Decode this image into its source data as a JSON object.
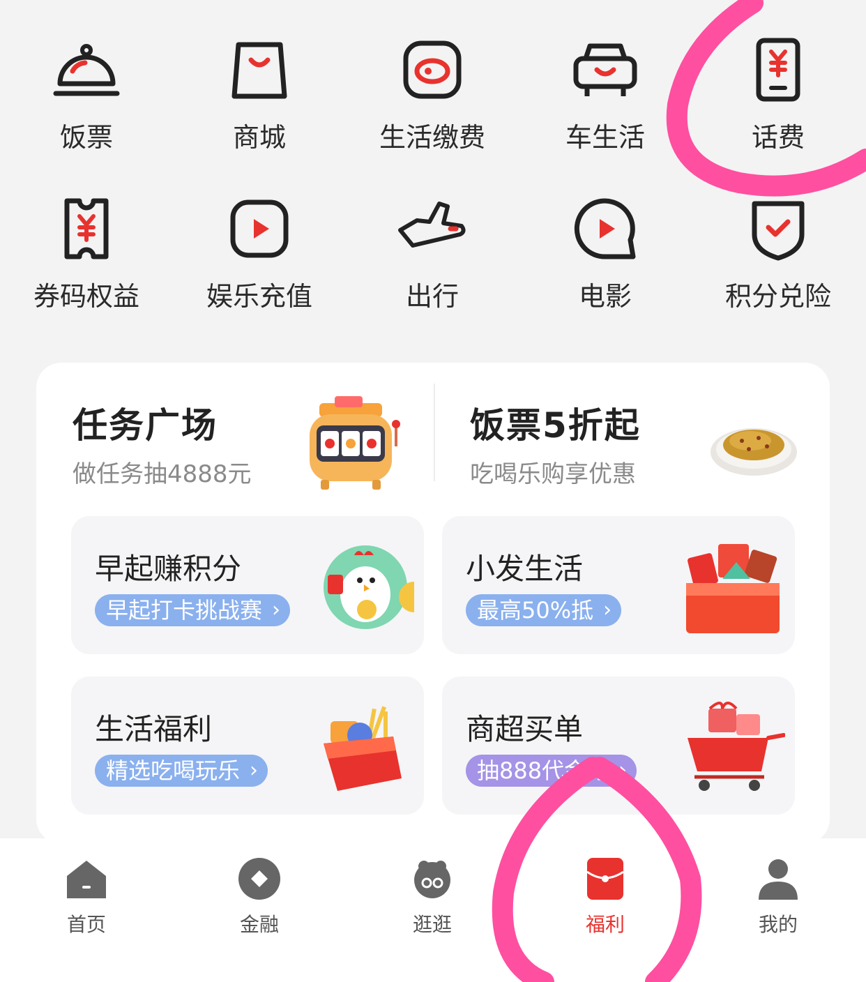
{
  "grid": {
    "row1": [
      {
        "label": "饭票",
        "icon": "cloche-icon"
      },
      {
        "label": "商城",
        "icon": "shopping-bag-icon"
      },
      {
        "label": "生活缴费",
        "icon": "bill-pay-icon"
      },
      {
        "label": "车生活",
        "icon": "car-icon"
      },
      {
        "label": "话费",
        "icon": "phone-bill-icon"
      }
    ],
    "row2": [
      {
        "label": "券码权益",
        "icon": "coupon-icon"
      },
      {
        "label": "娱乐充值",
        "icon": "play-icon"
      },
      {
        "label": "出行",
        "icon": "plane-icon"
      },
      {
        "label": "电影",
        "icon": "movie-icon"
      },
      {
        "label": "积分兑险",
        "icon": "shield-check-icon"
      }
    ]
  },
  "promos": [
    {
      "title": "任务广场",
      "subtitle": "做任务抽4888元"
    },
    {
      "title": "饭票5折起",
      "subtitle": "吃喝乐购享优惠"
    }
  ],
  "tiles": [
    {
      "title": "早起赚积分",
      "pill": "早起打卡挑战赛"
    },
    {
      "title": "小发生活",
      "pill": "最高50%抵"
    },
    {
      "title": "生活福利",
      "pill": "精选吃喝玩乐"
    },
    {
      "title": "商超买单",
      "pill": "抽888代金券"
    }
  ],
  "nav": [
    {
      "label": "首页",
      "icon": "home-icon"
    },
    {
      "label": "金融",
      "icon": "finance-icon"
    },
    {
      "label": "逛逛",
      "icon": "browse-icon"
    },
    {
      "label": "福利",
      "icon": "red-envelope-icon"
    },
    {
      "label": "我的",
      "icon": "profile-icon"
    }
  ],
  "colors": {
    "accent": "#e8322e",
    "annotation": "#ff4fa0",
    "pill_blue": "#8ab0ee",
    "pill_purple": "#a493e6"
  }
}
